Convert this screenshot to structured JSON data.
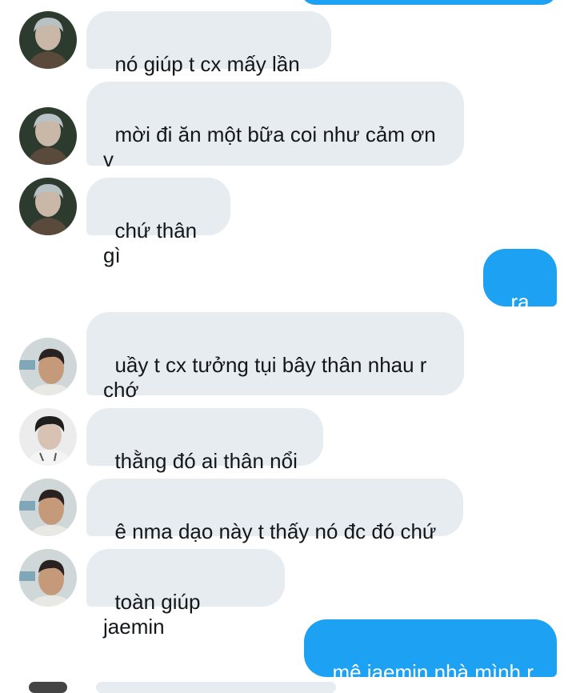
{
  "messages": [
    {
      "side": "received",
      "avatar": "friend-a",
      "text": "nó giúp t cx mấy lần r"
    },
    {
      "side": "received",
      "avatar": "friend-a",
      "text": "mời đi ăn một bữa coi như cảm ơn v"
    },
    {
      "side": "received",
      "avatar": "friend-a",
      "text": "chứ thân gì"
    },
    {
      "side": "sent",
      "text": "ra v"
    },
    {
      "side": "received",
      "avatar": "friend-b",
      "text": "uầy t cx tưởng tụi bây thân nhau r chớ"
    },
    {
      "side": "received",
      "avatar": "friend-c",
      "text": "thằng đó ai thân nổi"
    },
    {
      "side": "received",
      "avatar": "friend-b",
      "text": "ê nma dạo này t thấy nó đc đó chứ"
    },
    {
      "side": "received",
      "avatar": "friend-b",
      "text": "toàn giúp jaemin"
    },
    {
      "side": "sent",
      "text": "mê jaemin nhà mình r"
    }
  ],
  "colors": {
    "sent_bubble": "#1da1f2",
    "received_bubble": "#e6ecf0",
    "text": "#14171a"
  }
}
